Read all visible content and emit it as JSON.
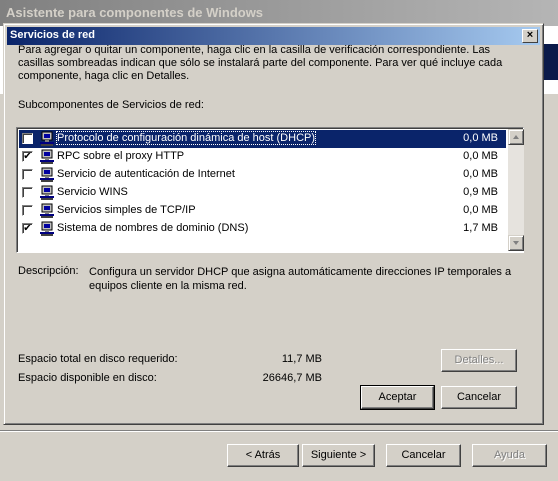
{
  "wizard": {
    "title": "Asistente para componentes de Windows",
    "back_label": "< Atrás",
    "next_label": "Siguiente >",
    "cancel_label": "Cancelar",
    "help_label": "Ayuda"
  },
  "dialog": {
    "title": "Servicios de red",
    "close_label": "×",
    "instructions": "Para agregar o quitar un componente, haga clic en la casilla de verificación correspondiente. Las casillas sombreadas indican que sólo se instalará parte del componente. Para ver qué incluye cada componente, haga clic en Detalles.",
    "list_label": "Subcomponentes de Servicios de red:",
    "items": [
      {
        "name": "Protocolo de configuración dinámica de host (DHCP)",
        "size": "0,0 MB",
        "checked": false,
        "selected": true
      },
      {
        "name": "RPC sobre el proxy HTTP",
        "size": "0,0 MB",
        "checked": true,
        "selected": false
      },
      {
        "name": "Servicio de autenticación de Internet",
        "size": "0,0 MB",
        "checked": false,
        "selected": false
      },
      {
        "name": "Servicio WINS",
        "size": "0,9 MB",
        "checked": false,
        "selected": false
      },
      {
        "name": "Servicios simples de TCP/IP",
        "size": "0,0 MB",
        "checked": false,
        "selected": false
      },
      {
        "name": "Sistema de nombres de dominio (DNS)",
        "size": "1,7 MB",
        "checked": true,
        "selected": false
      }
    ],
    "description_label": "Descripción:",
    "description_text": "Configura un servidor DHCP que asigna automáticamente direcciones IP temporales a equipos cliente en la misma red.",
    "space_required_label": "Espacio total en disco requerido:",
    "space_required_value": "11,7 MB",
    "space_available_label": "Espacio disponible en disco:",
    "space_available_value": "26646,7 MB",
    "details_label": "Detalles...",
    "ok_label": "Aceptar",
    "cancel_label": "Cancelar"
  },
  "icons": {
    "component": "network-service-icon"
  },
  "colors": {
    "title_active": "#0a246a",
    "title_inactive": "#808080",
    "face": "#d4d0c8"
  }
}
